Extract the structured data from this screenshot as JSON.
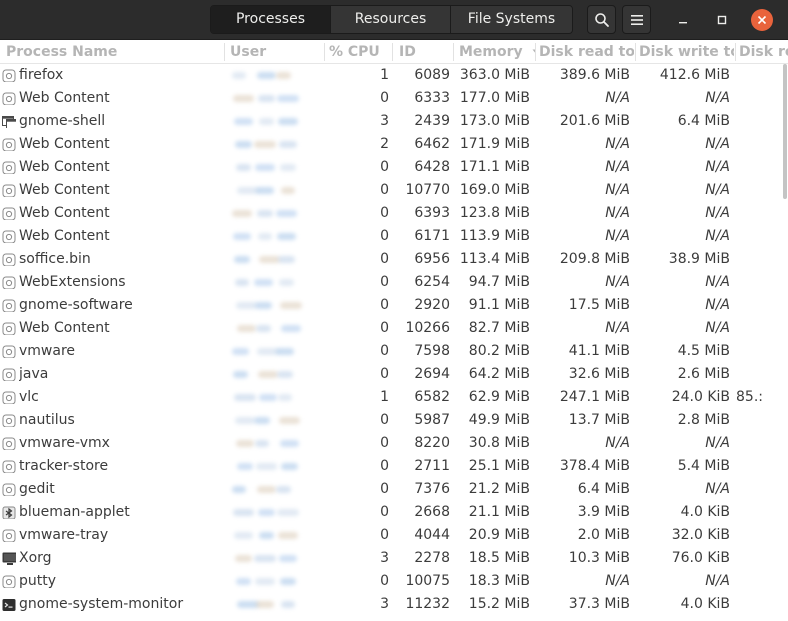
{
  "tabs": [
    {
      "label": "Processes"
    },
    {
      "label": "Resources"
    },
    {
      "label": "File Systems"
    }
  ],
  "header_icons": {
    "search": "search-icon",
    "menu": "hamburger-menu-icon",
    "minimize": "minimize-icon",
    "maximize": "maximize-icon",
    "close": "close-icon"
  },
  "colors": {
    "headerbar": "#2c2c2c",
    "close_button": "#e9633c",
    "text": "#3c3c3c",
    "column_header_text": "#b5b5b5"
  },
  "columns": {
    "name": "Process Name",
    "user": "User",
    "cpu": "% CPU",
    "id": "ID",
    "memory": "Memory",
    "disk_read": "Disk read tot",
    "disk_write": "Disk write to",
    "disk_extra": "Disk re"
  },
  "sort": {
    "column": "memory",
    "direction": "descending"
  },
  "processes": [
    {
      "name": "firefox",
      "icon": "app-icon",
      "cpu": "1",
      "id": "6089",
      "memory": "363.0 MiB",
      "disk_read": "389.6 MiB",
      "disk_write": "412.6 MiB",
      "disk_extra": ""
    },
    {
      "name": "Web Content",
      "icon": "app-icon",
      "cpu": "0",
      "id": "6333",
      "memory": "177.0 MiB",
      "disk_read": "N/A",
      "disk_write": "N/A",
      "disk_extra": ""
    },
    {
      "name": "gnome-shell",
      "icon": "window-icon",
      "cpu": "3",
      "id": "2439",
      "memory": "173.0 MiB",
      "disk_read": "201.6 MiB",
      "disk_write": "6.4 MiB",
      "disk_extra": ""
    },
    {
      "name": "Web Content",
      "icon": "app-icon",
      "cpu": "2",
      "id": "6462",
      "memory": "171.9 MiB",
      "disk_read": "N/A",
      "disk_write": "N/A",
      "disk_extra": ""
    },
    {
      "name": "Web Content",
      "icon": "app-icon",
      "cpu": "0",
      "id": "6428",
      "memory": "171.1 MiB",
      "disk_read": "N/A",
      "disk_write": "N/A",
      "disk_extra": ""
    },
    {
      "name": "Web Content",
      "icon": "app-icon",
      "cpu": "0",
      "id": "10770",
      "memory": "169.0 MiB",
      "disk_read": "N/A",
      "disk_write": "N/A",
      "disk_extra": ""
    },
    {
      "name": "Web Content",
      "icon": "app-icon",
      "cpu": "0",
      "id": "6393",
      "memory": "123.8 MiB",
      "disk_read": "N/A",
      "disk_write": "N/A",
      "disk_extra": ""
    },
    {
      "name": "Web Content",
      "icon": "app-icon",
      "cpu": "0",
      "id": "6171",
      "memory": "113.9 MiB",
      "disk_read": "N/A",
      "disk_write": "N/A",
      "disk_extra": ""
    },
    {
      "name": "soffice.bin",
      "icon": "app-icon",
      "cpu": "0",
      "id": "6956",
      "memory": "113.4 MiB",
      "disk_read": "209.8 MiB",
      "disk_write": "38.9 MiB",
      "disk_extra": ""
    },
    {
      "name": "WebExtensions",
      "icon": "app-icon",
      "cpu": "0",
      "id": "6254",
      "memory": "94.7 MiB",
      "disk_read": "N/A",
      "disk_write": "N/A",
      "disk_extra": ""
    },
    {
      "name": "gnome-software",
      "icon": "app-icon",
      "cpu": "0",
      "id": "2920",
      "memory": "91.1 MiB",
      "disk_read": "17.5 MiB",
      "disk_write": "N/A",
      "disk_extra": ""
    },
    {
      "name": "Web Content",
      "icon": "app-icon",
      "cpu": "0",
      "id": "10266",
      "memory": "82.7 MiB",
      "disk_read": "N/A",
      "disk_write": "N/A",
      "disk_extra": ""
    },
    {
      "name": "vmware",
      "icon": "app-icon",
      "cpu": "0",
      "id": "7598",
      "memory": "80.2 MiB",
      "disk_read": "41.1 MiB",
      "disk_write": "4.5 MiB",
      "disk_extra": ""
    },
    {
      "name": "java",
      "icon": "app-icon",
      "cpu": "0",
      "id": "2694",
      "memory": "64.2 MiB",
      "disk_read": "32.6 MiB",
      "disk_write": "2.6 MiB",
      "disk_extra": ""
    },
    {
      "name": "vlc",
      "icon": "app-icon",
      "cpu": "1",
      "id": "6582",
      "memory": "62.9 MiB",
      "disk_read": "247.1 MiB",
      "disk_write": "24.0 KiB",
      "disk_extra": "85.:"
    },
    {
      "name": "nautilus",
      "icon": "app-icon",
      "cpu": "0",
      "id": "5987",
      "memory": "49.9 MiB",
      "disk_read": "13.7 MiB",
      "disk_write": "2.8 MiB",
      "disk_extra": ""
    },
    {
      "name": "vmware-vmx",
      "icon": "app-icon",
      "cpu": "0",
      "id": "8220",
      "memory": "30.8 MiB",
      "disk_read": "N/A",
      "disk_write": "N/A",
      "disk_extra": ""
    },
    {
      "name": "tracker-store",
      "icon": "app-icon",
      "cpu": "0",
      "id": "2711",
      "memory": "25.1 MiB",
      "disk_read": "378.4 MiB",
      "disk_write": "5.4 MiB",
      "disk_extra": ""
    },
    {
      "name": "gedit",
      "icon": "app-icon",
      "cpu": "0",
      "id": "7376",
      "memory": "21.2 MiB",
      "disk_read": "6.4 MiB",
      "disk_write": "N/A",
      "disk_extra": ""
    },
    {
      "name": "blueman-applet",
      "icon": "bluetooth-icon",
      "cpu": "0",
      "id": "2668",
      "memory": "21.1 MiB",
      "disk_read": "3.9 MiB",
      "disk_write": "4.0 KiB",
      "disk_extra": ""
    },
    {
      "name": "vmware-tray",
      "icon": "app-icon",
      "cpu": "0",
      "id": "4044",
      "memory": "20.9 MiB",
      "disk_read": "2.0 MiB",
      "disk_write": "32.0 KiB",
      "disk_extra": ""
    },
    {
      "name": "Xorg",
      "icon": "monitor-icon",
      "cpu": "3",
      "id": "2278",
      "memory": "18.5 MiB",
      "disk_read": "10.3 MiB",
      "disk_write": "76.0 KiB",
      "disk_extra": ""
    },
    {
      "name": "putty",
      "icon": "app-icon",
      "cpu": "0",
      "id": "10075",
      "memory": "18.3 MiB",
      "disk_read": "N/A",
      "disk_write": "N/A",
      "disk_extra": ""
    },
    {
      "name": "gnome-system-monitor",
      "icon": "terminal-icon",
      "cpu": "3",
      "id": "11232",
      "memory": "15.2 MiB",
      "disk_read": "37.3 MiB",
      "disk_write": "4.0 KiB",
      "disk_extra": ""
    }
  ]
}
